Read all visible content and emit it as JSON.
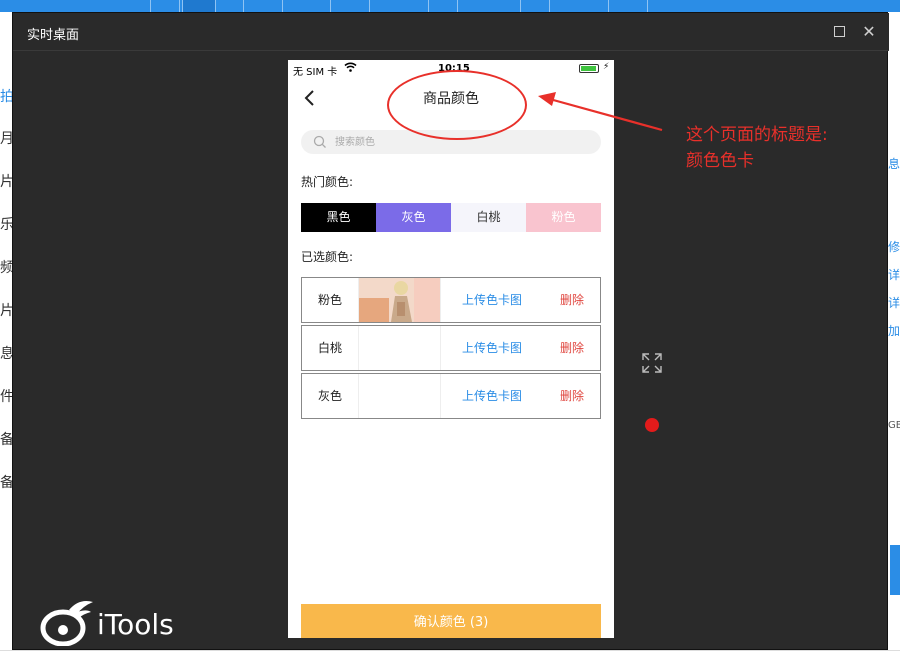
{
  "background_app": {
    "left_edge_labels": [
      "拍",
      "月",
      "片",
      "乐",
      "频",
      "片",
      "息",
      "件",
      "备",
      "备"
    ],
    "right_edge_labels": [
      "息",
      "修",
      "详",
      "详",
      "加",
      "GB"
    ]
  },
  "window": {
    "title": "实时桌面",
    "maximize_label": "",
    "close_label": "✕"
  },
  "status_bar": {
    "carrier": "无 SIM 卡",
    "time": "10:15"
  },
  "nav": {
    "title": "商品颜色"
  },
  "search": {
    "placeholder": "搜索颜色"
  },
  "hot_colors": {
    "label": "热门颜色:",
    "chips": [
      {
        "label": "黑色",
        "bg": "#000000",
        "fg": "#ffffff"
      },
      {
        "label": "灰色",
        "bg": "#7b6be8",
        "fg": "#ffffff"
      },
      {
        "label": "白桃",
        "bg": "#f5f5fb",
        "fg": "#333333"
      },
      {
        "label": "粉色",
        "bg": "#f9c4cf",
        "fg": "#ffffff"
      }
    ]
  },
  "selected_colors": {
    "label": "已选颜色:",
    "rows": [
      {
        "name": "粉色",
        "upload": "上传色卡图",
        "delete": "删除"
      },
      {
        "name": "白桃",
        "upload": "上传色卡图",
        "delete": "删除"
      },
      {
        "name": "灰色",
        "upload": "上传色卡图",
        "delete": "删除"
      }
    ]
  },
  "confirm_button": "确认颜色 (3)",
  "annotation": {
    "line1": "这个页面的标题是:",
    "line2": "颜色色卡",
    "color": "#e8302a"
  },
  "logo": {
    "text": "iTools"
  }
}
